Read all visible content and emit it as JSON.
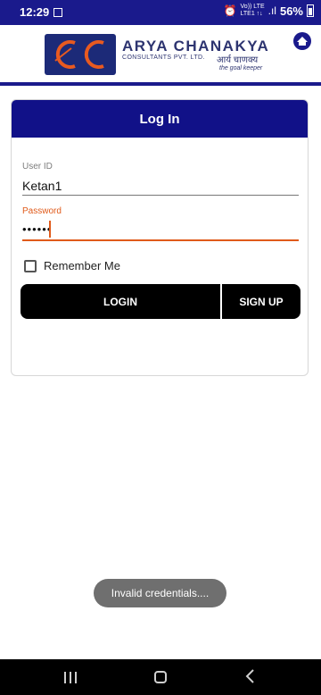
{
  "status_bar": {
    "time": "12:29",
    "image_icon": "image-icon",
    "network_label_top": "Vo)) LTE",
    "network_label_bottom": "LTE1 ↑↓",
    "battery": "56%"
  },
  "header": {
    "brand_name": "ARYA CHANAKYA",
    "brand_sub": "CONSULTANTS PVT. LTD.",
    "brand_hindi": "आर्य चाणक्य",
    "brand_tagline": "the goal keeper",
    "home_icon": "home-icon"
  },
  "card": {
    "title": "Log In"
  },
  "form": {
    "user_id_label": "User ID",
    "user_id_value": "Ketan1",
    "password_label": "Password",
    "password_value": "••••••",
    "remember_label": "Remember Me"
  },
  "buttons": {
    "login": "LOGIN",
    "signup": "SIGN UP"
  },
  "toast": {
    "message": "Invalid credentials...."
  },
  "nav": {
    "recents": "recents-icon",
    "home": "home-nav-icon",
    "back": "back-icon"
  },
  "colors": {
    "brand_navy": "#1a1a8c",
    "card_header": "#111188",
    "accent_orange": "#e05a1a"
  }
}
